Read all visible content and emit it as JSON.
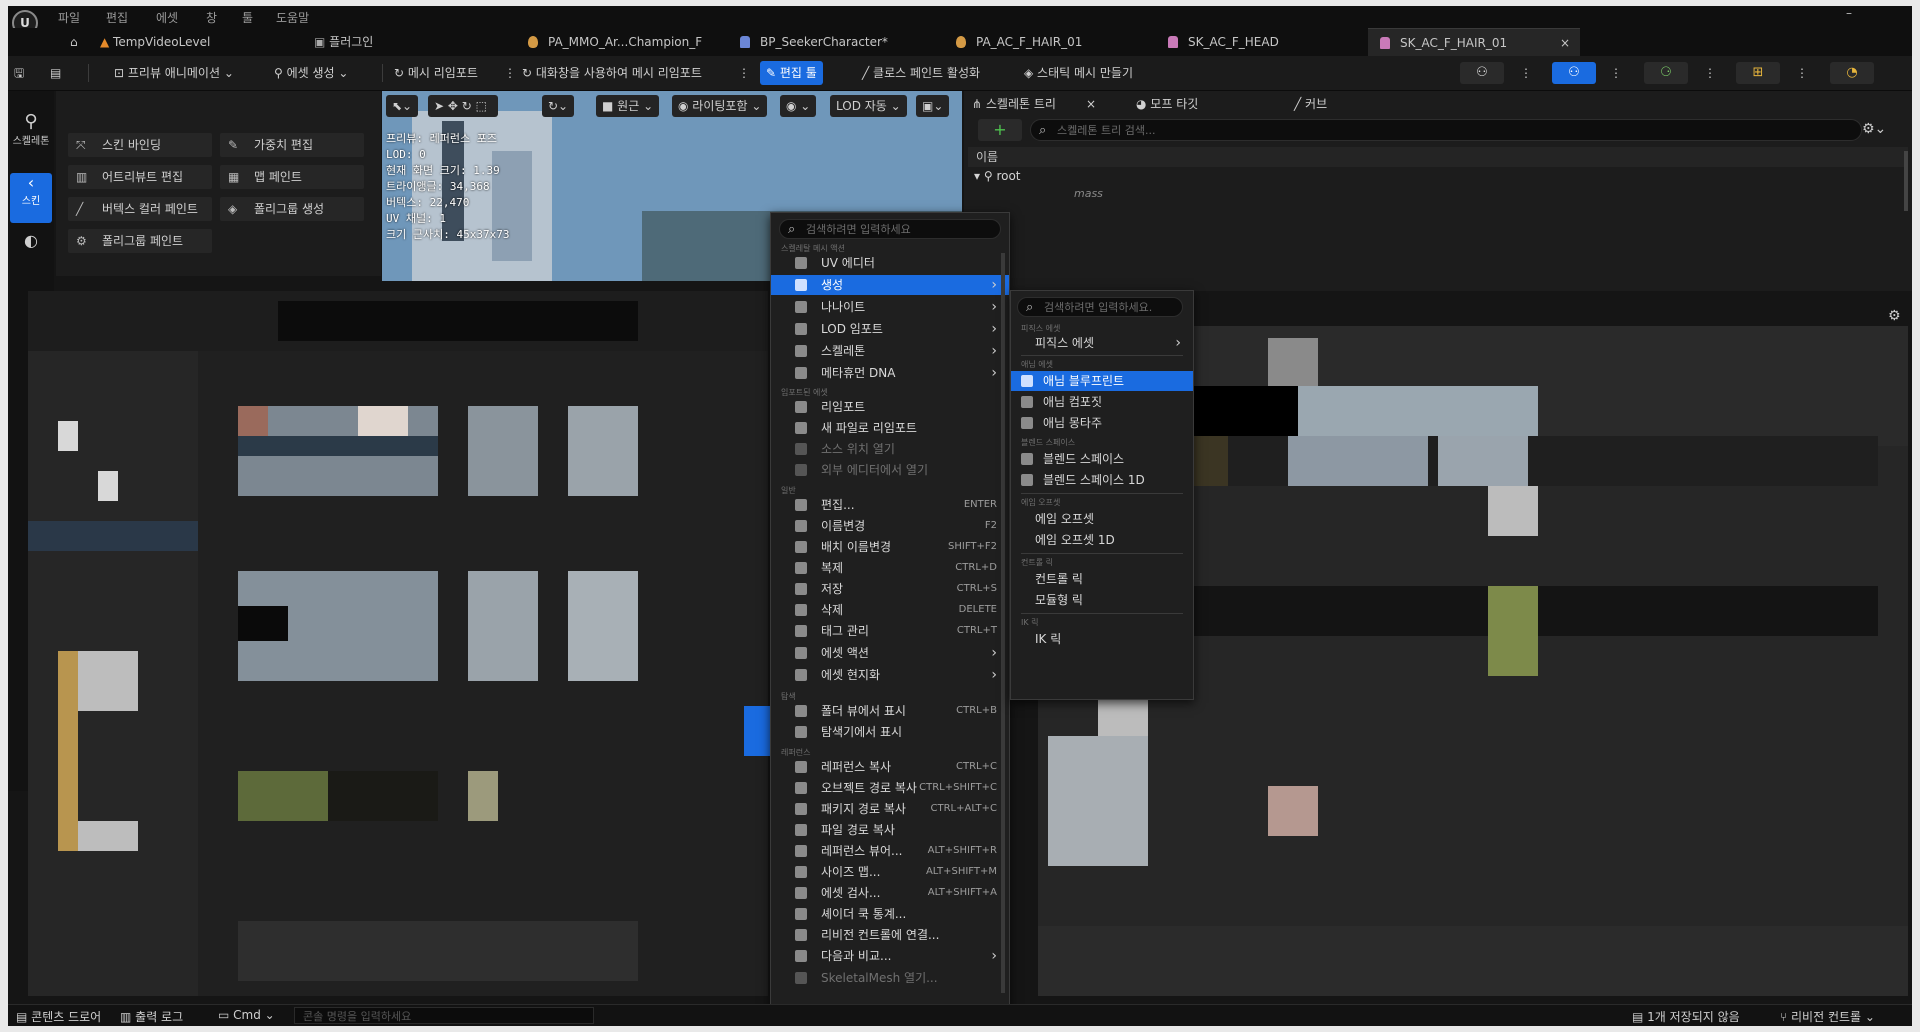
{
  "menubar": {
    "items": [
      "파일",
      "편집",
      "에셋",
      "창",
      "툴",
      "도움말"
    ]
  },
  "tabs": [
    {
      "label": "TempVideoLevel"
    },
    {
      "label": "플러그인"
    },
    {
      "label": "PA_MMO_Ar...Champion_F"
    },
    {
      "label": "BP_SeekerCharacter*"
    },
    {
      "label": "PA_AC_F_HAIR_01"
    },
    {
      "label": "SK_AC_F_HEAD"
    },
    {
      "label": "SK_AC_F_HAIR_01",
      "close": "×"
    }
  ],
  "toolbar": {
    "preview_anim": "프리뷰 애니메이션",
    "create_asset": "에셋 생성",
    "reimport_mesh": "메시 리임포트",
    "reimport_mesh_dialog": "대화창을 사용하여 메시 리임포트",
    "edit_tool": "편집 툴",
    "cloth_paint": "클로스 페인트 활성화",
    "make_static": "스태틱 메시 만들기"
  },
  "modes": {
    "skeleton": "스켈레톤",
    "skin": "스킨"
  },
  "tools": {
    "skin_binding": "스킨 바인딩",
    "weight_edit": "가중치 편집",
    "attribute_edit": "어트리뷰트 편집",
    "map_paint": "맵 페인트",
    "vertex_color_paint": "버텍스 컬러 페인트",
    "polygroup_create": "폴리그룹 생성",
    "polygroup_paint": "폴리그룹 페인트"
  },
  "viewport": {
    "perspective": "원근",
    "lighting": "라이팅포함",
    "lod": "LOD 자동",
    "stats": [
      "프리뷰: 레퍼런스 포즈",
      "LOD: 0",
      "현재 화면 크기: 1.39",
      "트라이앵글: 34,368",
      "버텍스: 22,470",
      "UV 채널: 1",
      "크기 근사치: 45x37x73"
    ]
  },
  "skeleton_panel": {
    "tab_tree": "스켈레톤 트리",
    "tab_morph": "모프 타깃",
    "tab_curve": "커브",
    "search_placeholder": "스켈레톤 트리 검색...",
    "column_name": "이름",
    "root": "root",
    "mass": "mass"
  },
  "context_menu": {
    "search_placeholder": "검색하려면 입력하세요",
    "sections": {
      "skeletal": "스켈레탈 메시 액션",
      "imported": "임포트된 에셋",
      "general": "일반",
      "explore": "탐색",
      "references": "레퍼런스"
    },
    "items": [
      {
        "label": "UV 에디터"
      },
      {
        "label": "생성",
        "arrow": "›"
      },
      {
        "label": "나나이트",
        "arrow": "›"
      },
      {
        "label": "LOD 임포트",
        "arrow": "›"
      },
      {
        "label": "스켈레톤",
        "arrow": "›"
      },
      {
        "label": "메타휴먼 DNA",
        "arrow": "›"
      },
      {
        "label": "리임포트"
      },
      {
        "label": "새 파일로 리임포트"
      },
      {
        "label": "소스 위치 열기"
      },
      {
        "label": "외부 에디터에서 열기"
      },
      {
        "label": "편집...",
        "shortcut": "ENTER"
      },
      {
        "label": "이름변경",
        "shortcut": "F2"
      },
      {
        "label": "배치 이름변경",
        "shortcut": "SHIFT+F2"
      },
      {
        "label": "복제",
        "shortcut": "CTRL+D"
      },
      {
        "label": "저장",
        "shortcut": "CTRL+S"
      },
      {
        "label": "삭제",
        "shortcut": "DELETE"
      },
      {
        "label": "태그 관리",
        "shortcut": "CTRL+T"
      },
      {
        "label": "에셋 액션",
        "arrow": "›"
      },
      {
        "label": "에셋 현지화",
        "arrow": "›"
      },
      {
        "label": "폴더 뷰에서 표시",
        "shortcut": "CTRL+B"
      },
      {
        "label": "탐색기에서 표시"
      },
      {
        "label": "레퍼런스 복사",
        "shortcut": "CTRL+C"
      },
      {
        "label": "오브젝트 경로 복사",
        "shortcut": "CTRL+SHIFT+C"
      },
      {
        "label": "패키지 경로 복사",
        "shortcut": "CTRL+ALT+C"
      },
      {
        "label": "파일 경로 복사"
      },
      {
        "label": "레퍼런스 뷰어...",
        "shortcut": "ALT+SHIFT+R"
      },
      {
        "label": "사이즈 맵...",
        "shortcut": "ALT+SHIFT+M"
      },
      {
        "label": "에셋 검사...",
        "shortcut": "ALT+SHIFT+A"
      },
      {
        "label": "셰이더 쿡 통계..."
      },
      {
        "label": "리비전 컨트롤에 연결..."
      },
      {
        "label": "다음과 비교...",
        "arrow": "›"
      },
      {
        "label": "SkeletalMesh 열기..."
      }
    ]
  },
  "submenu": {
    "search_placeholder": "검색하려면 입력하세요.",
    "sections": {
      "physics": "피직스 에셋",
      "anim": "애님 에셋",
      "blendspace": "블렌드 스페이스",
      "aimoffset": "에임 오프셋",
      "controlrig": "컨트롤 릭",
      "ik": "IK 릭"
    },
    "items": [
      {
        "label": "피직스 에셋",
        "arrow": "›"
      },
      {
        "label": "애님 블루프린트"
      },
      {
        "label": "애님 컴포짓"
      },
      {
        "label": "애님 몽타주"
      },
      {
        "label": "블렌드 스페이스"
      },
      {
        "label": "블렌드 스페이스 1D"
      },
      {
        "label": "에임 오프셋"
      },
      {
        "label": "에임 오프셋 1D"
      },
      {
        "label": "컨트롤 릭"
      },
      {
        "label": "모듈형 릭"
      },
      {
        "label": "IK 릭"
      }
    ]
  },
  "statusbar": {
    "content_drawer": "콘텐츠 드로어",
    "output_log": "출력 로그",
    "cmd": "Cmd",
    "console_placeholder": "콘솔 명령을 입력하세요",
    "unsaved": "1개 저장되지 않음",
    "revision": "리비전 컨트롤"
  },
  "colors": {
    "accent": "#1a6be0",
    "background": "#151515",
    "menu_bg": "#1f1f1f"
  }
}
